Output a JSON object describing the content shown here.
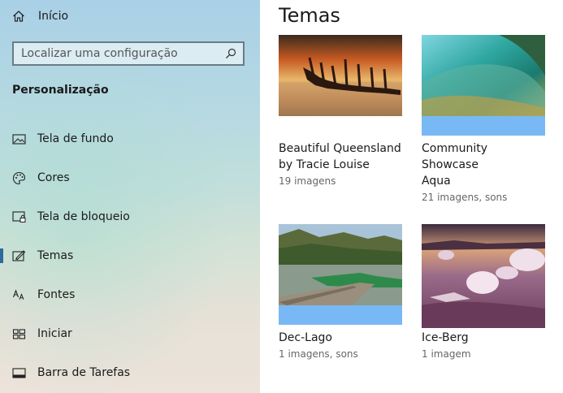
{
  "sidebar": {
    "home_label": "Início",
    "search_placeholder": "Localizar uma configuração",
    "section_title": "Personalização",
    "items": [
      {
        "label": "Tela de fundo",
        "icon": "picture-icon"
      },
      {
        "label": "Cores",
        "icon": "palette-icon"
      },
      {
        "label": "Tela de bloqueio",
        "icon": "lock-screen-icon"
      },
      {
        "label": "Temas",
        "icon": "themes-icon",
        "selected": true
      },
      {
        "label": "Fontes",
        "icon": "fonts-icon"
      },
      {
        "label": "Iniciar",
        "icon": "start-icon"
      },
      {
        "label": "Barra de Tarefas",
        "icon": "taskbar-icon"
      }
    ]
  },
  "main": {
    "title": "Temas",
    "themes": [
      {
        "name_line1": "Beautiful Queensland",
        "name_line2": "by Tracie Louise",
        "meta": "19 imagens",
        "accent": "#ffffff"
      },
      {
        "name_line1": "Community Showcase",
        "name_line2": "Aqua",
        "meta": "21 imagens, sons",
        "accent": "#78b9f5"
      },
      {
        "name_line1": "Dec-Lago",
        "name_line2": "",
        "meta": "1 imagens, sons",
        "accent": "#78b9f5"
      },
      {
        "name_line1": "Ice-Berg",
        "name_line2": "",
        "meta": "1 imagem",
        "accent": "#ffffff"
      }
    ]
  },
  "colors": {
    "selection_bar": "#2e6b99",
    "accent_strip": "#78b9f5"
  }
}
